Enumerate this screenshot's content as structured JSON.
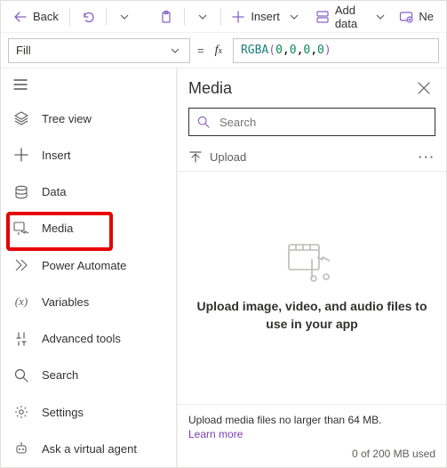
{
  "topbar": {
    "back": "Back",
    "insert": "Insert",
    "addData": "Add data",
    "newScreen": "Ne"
  },
  "formula": {
    "property": "Fill",
    "fn": "RGBA",
    "args": [
      "0",
      "0",
      "0",
      "0"
    ]
  },
  "sidebar": {
    "items": [
      {
        "label": "Tree view"
      },
      {
        "label": "Insert"
      },
      {
        "label": "Data"
      },
      {
        "label": "Media"
      },
      {
        "label": "Power Automate"
      },
      {
        "label": "Variables"
      },
      {
        "label": "Advanced tools"
      },
      {
        "label": "Search"
      },
      {
        "label": "Settings"
      },
      {
        "label": "Ask a virtual agent"
      }
    ]
  },
  "panel": {
    "title": "Media",
    "searchPlaceholder": "Search",
    "uploadLabel": "Upload",
    "emptyText": "Upload image, video, and audio files to use in your app",
    "footerHint": "Upload media files no larger than 64 MB.",
    "learnMore": "Learn more",
    "usage": "0 of 200 MB used"
  }
}
